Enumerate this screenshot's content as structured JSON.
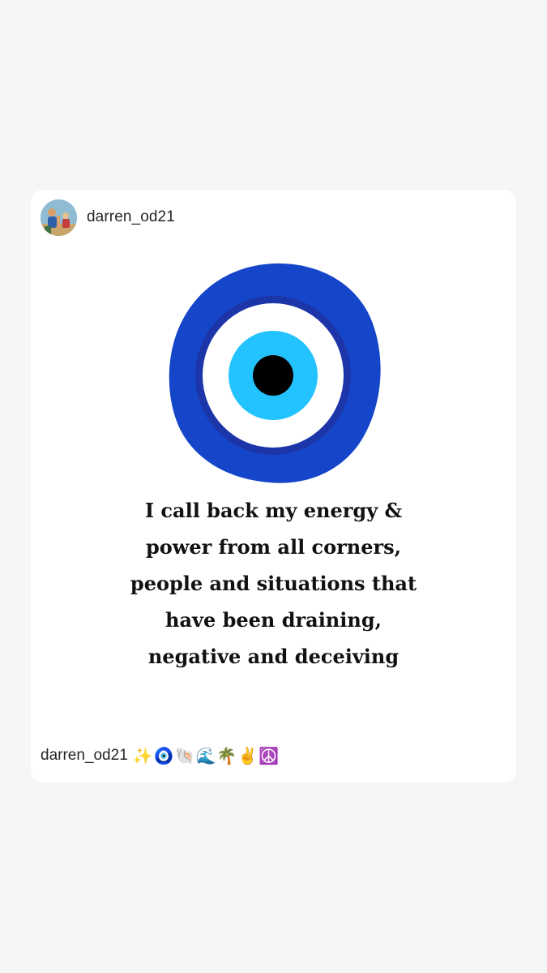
{
  "post": {
    "username": "darren_od21",
    "quote": "I call back my energy &\npower from all corners,\npeople and situations that\nhave been draining,\nnegative and deceiving",
    "caption": {
      "username": "darren_od21",
      "emojis": "✨🧿🐚🌊🌴✌️☮️"
    }
  },
  "icons": {
    "avatar": "profile-photo",
    "graphic": "evil-eye-nazar"
  },
  "colors": {
    "eye_outer": "#1546c9",
    "eye_ring": "#1c35a8",
    "eye_white": "#ffffff",
    "eye_iris": "#23c3ff",
    "eye_pupil": "#000000"
  }
}
